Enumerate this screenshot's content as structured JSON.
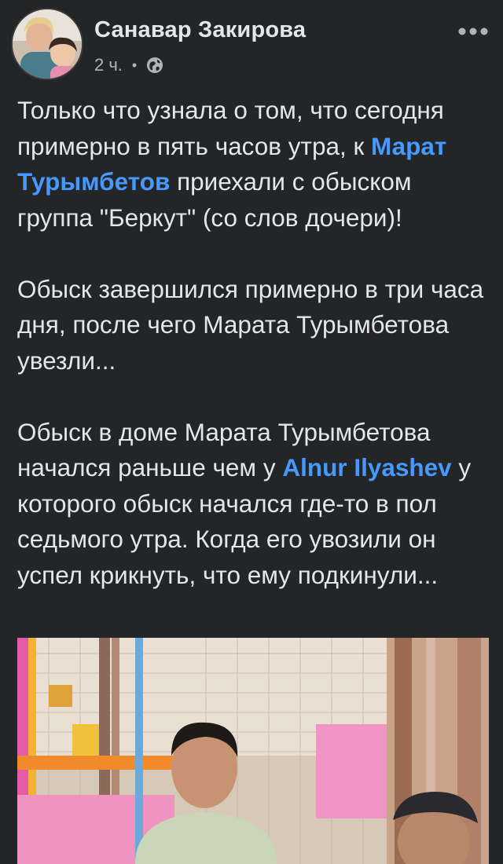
{
  "post": {
    "author": "Санавар Закирова",
    "time": "2 ч.",
    "separator": "•",
    "privacy_icon": "globe-icon",
    "more_icon": "more-horizontal-icon"
  },
  "content": {
    "p1": {
      "t1": "Только что узнала о том, что сегодня примерно в пять часов утра, к ",
      "mention": "Марат Турымбетов",
      "t2": "  приехали с обыском группа \"Беркут\" (со слов дочери)!"
    },
    "p2": {
      "t1": "Обыск завершился примерно в три часа дня, после чего Марата Турымбетова увезли..."
    },
    "p3": {
      "t1": "Обыск в доме Марата Турымбетова начался раньше чем у ",
      "mention": "Alnur Ilyashev",
      "t2": " у которого обыск начался где-то в пол седьмого утра. Когда его увозили он успел крикнуть, что ему подкинули..."
    }
  },
  "colors": {
    "background": "#242526",
    "text": "#e4e6eb",
    "meta": "#b0b3b8",
    "mention": "#4599ff"
  }
}
